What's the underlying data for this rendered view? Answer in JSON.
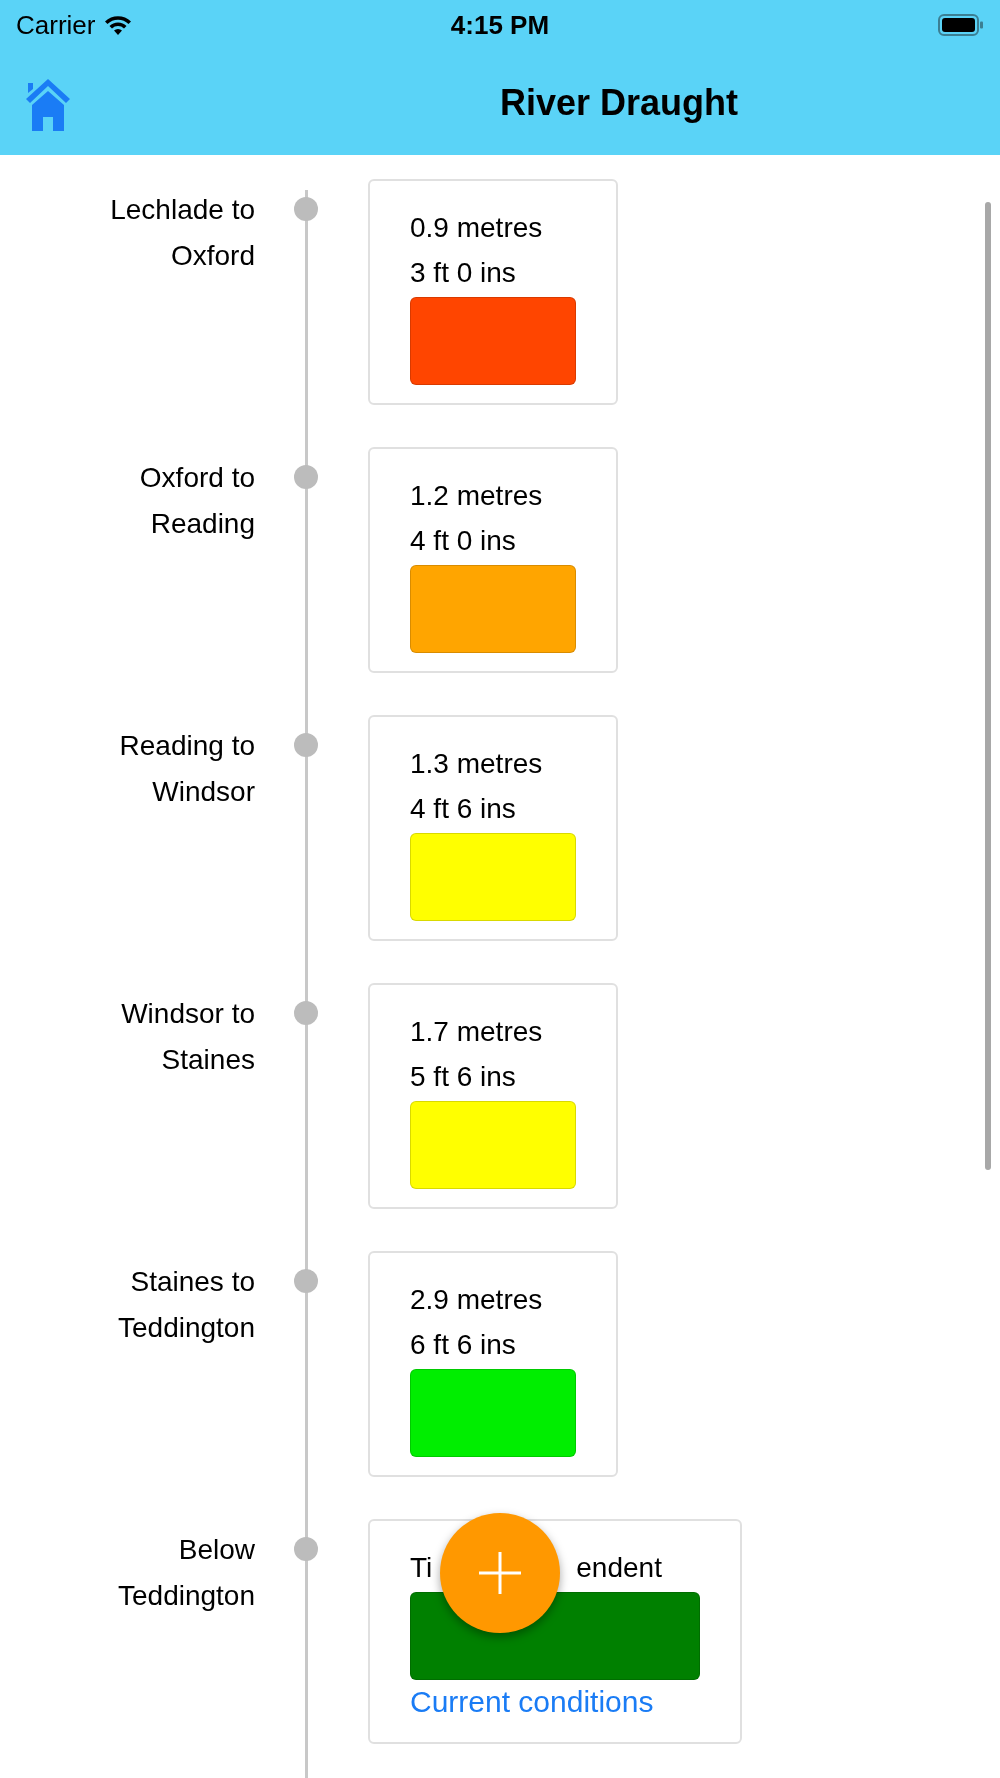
{
  "status_bar": {
    "carrier": "Carrier",
    "time": "4:15 PM"
  },
  "nav_bar": {
    "title": "River Draught"
  },
  "sections": [
    {
      "kind": "depth",
      "label": "Lechlade to Oxford",
      "lines": [
        "0.9 metres",
        "3 ft 0 ins"
      ],
      "color": "#ff4500"
    },
    {
      "kind": "depth",
      "label": "Oxford to Reading",
      "lines": [
        "1.2 metres",
        "4 ft 0 ins"
      ],
      "color": "#ffa500"
    },
    {
      "kind": "depth",
      "label": "Reading to Windsor",
      "lines": [
        "1.3 metres",
        "4 ft 6 ins"
      ],
      "color": "#ffff00"
    },
    {
      "kind": "depth",
      "label": "Windsor to Staines",
      "lines": [
        "1.7 metres",
        "5 ft 6 ins"
      ],
      "color": "#ffff00"
    },
    {
      "kind": "depth",
      "label": "Staines to Teddington",
      "lines": [
        "2.9 metres",
        "6 ft 6 ins"
      ],
      "color": "#00ee00"
    },
    {
      "kind": "tidal",
      "label": "Below Teddington",
      "text_parts": [
        "Ti",
        "endent"
      ],
      "color": "#008000",
      "link": "Current conditions"
    }
  ]
}
